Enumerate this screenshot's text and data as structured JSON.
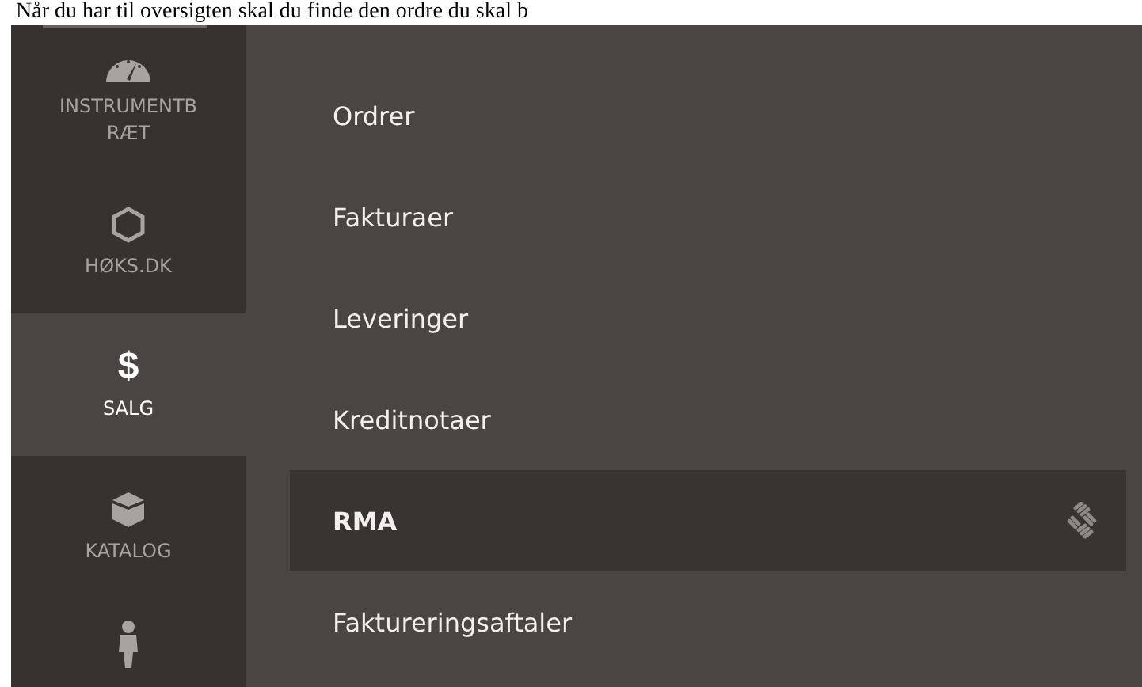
{
  "caption": "Når du har til oversigten skal du finde den ordre du skal b",
  "sidebar": {
    "items": [
      {
        "kind": "gauge",
        "label": "INSTRUMENTB RÆT",
        "selected": false
      },
      {
        "kind": "hexagon",
        "label": "HØKS.DK",
        "selected": false
      },
      {
        "kind": "dollar",
        "label": "SALG",
        "selected": true,
        "glyph": "$"
      },
      {
        "kind": "box",
        "label": "KATALOG",
        "selected": false
      },
      {
        "kind": "person",
        "selected": false
      }
    ]
  },
  "menu": {
    "items": [
      {
        "label": "Ordrer",
        "selected": false
      },
      {
        "label": "Fakturaer",
        "selected": false
      },
      {
        "label": "Leveringer",
        "selected": false
      },
      {
        "label": "Kreditnotaer",
        "selected": false
      },
      {
        "label": "RMA",
        "selected": true
      },
      {
        "label": "Faktureringsaftaler",
        "selected": false
      }
    ]
  }
}
